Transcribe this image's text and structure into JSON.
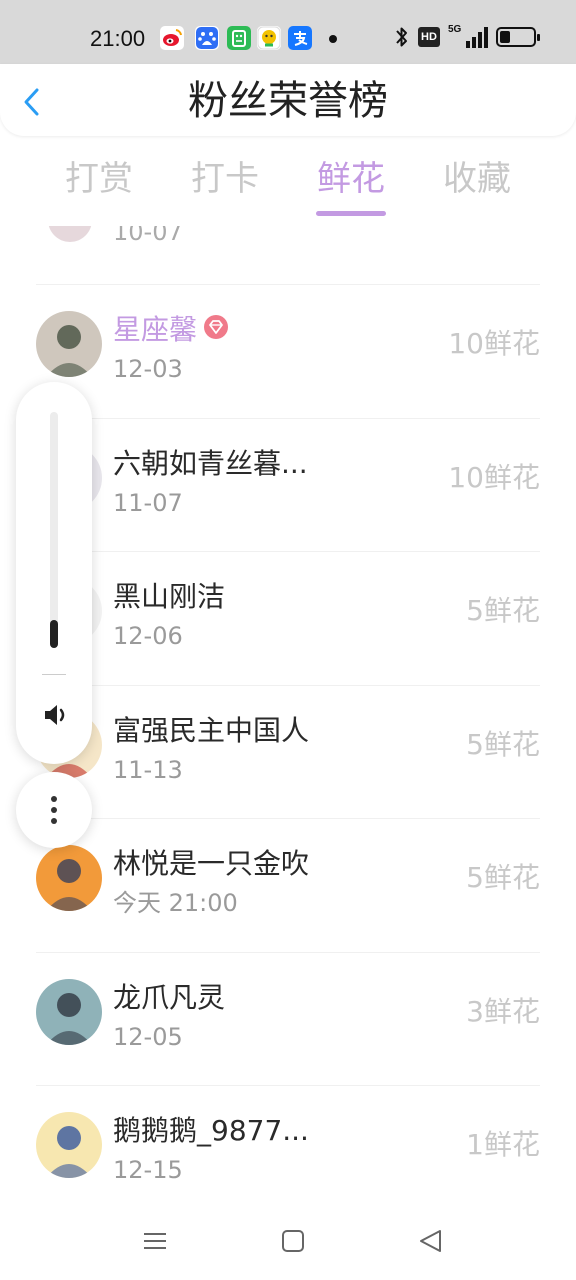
{
  "status_bar": {
    "time": "21:00",
    "apps": [
      {
        "icon": "weibo-icon",
        "color": "#e6162d"
      },
      {
        "icon": "baidu-icon",
        "color": "#2f6ef5"
      },
      {
        "icon": "app-green-icon",
        "color": "#2dbb55"
      },
      {
        "icon": "app-yellow-icon",
        "color": "#f2c200"
      },
      {
        "icon": "alipay-icon",
        "color": "#1677ff"
      }
    ],
    "network_badge": "HD",
    "network_type": "5G",
    "battery_level": 0.3
  },
  "header": {
    "title": "粉丝荣誉榜",
    "back_icon": "chevron-left-icon",
    "accent_color": "#2a9df4"
  },
  "tabs": [
    {
      "label": "打赏",
      "active": false
    },
    {
      "label": "打卡",
      "active": false
    },
    {
      "label": "鲜花",
      "active": true
    },
    {
      "label": "收藏",
      "active": false
    }
  ],
  "accent_color": "#c39ae2",
  "list": {
    "partial_top_date": "10-07",
    "items": [
      {
        "name": "星座馨",
        "date": "12-03",
        "amount": "10鲜花",
        "vip": true,
        "avatar_colors": [
          "#cfc7bd",
          "#3d4a3a"
        ]
      },
      {
        "name": "六朝如青丝暮...",
        "date": "11-07",
        "amount": "10鲜花",
        "vip": false,
        "avatar_colors": [
          "#e8e6ec",
          "#6b6f80"
        ]
      },
      {
        "name": "黑山刚洁",
        "date": "12-06",
        "amount": "5鲜花",
        "vip": false,
        "avatar_colors": [
          "#f2f2f2",
          "#555555"
        ]
      },
      {
        "name": "富强民主中国人",
        "date": "11-13",
        "amount": "5鲜花",
        "vip": false,
        "avatar_colors": [
          "#f5e6c8",
          "#c0221f"
        ]
      },
      {
        "name": "林悦是一只金吹",
        "date": "今天 21:00",
        "amount": "5鲜花",
        "vip": false,
        "avatar_colors": [
          "#f29a3a",
          "#2c3a5e"
        ]
      },
      {
        "name": "龙爪凡灵",
        "date": "12-05",
        "amount": "3鲜花",
        "vip": false,
        "avatar_colors": [
          "#8fb2b8",
          "#2a2f3a"
        ]
      },
      {
        "name": "鹅鹅鹅_9877...",
        "date": "12-15",
        "amount": "1鲜花",
        "vip": false,
        "avatar_colors": [
          "#f7e7b0",
          "#2b4f9e"
        ]
      }
    ]
  },
  "volume": {
    "level": 0.12,
    "speaker_icon": "speaker-icon",
    "more_icon": "more-vertical-icon"
  },
  "nav_bar": {
    "menu_icon": "menu-icon",
    "home_icon": "home-square-icon",
    "back_icon": "back-triangle-icon"
  }
}
